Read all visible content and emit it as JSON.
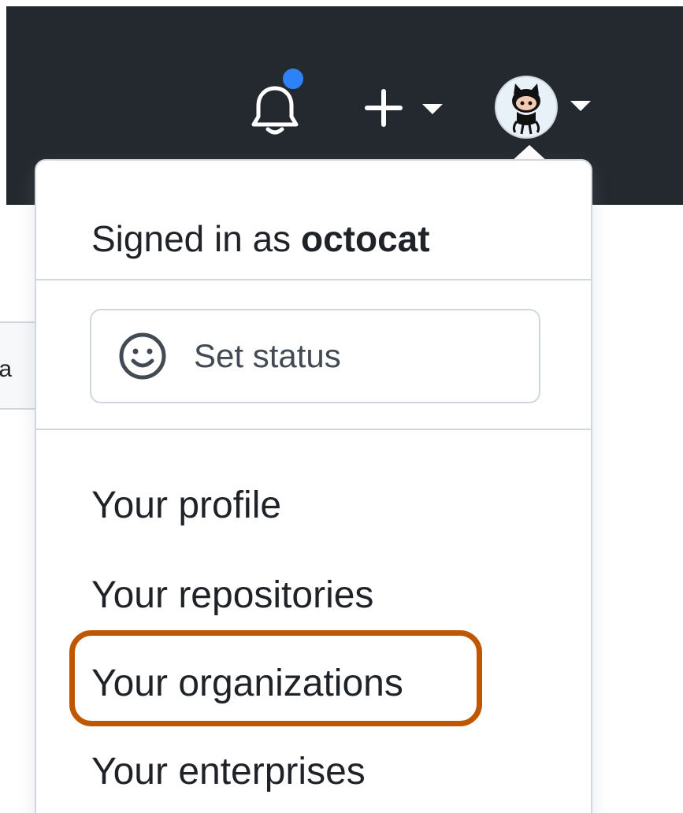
{
  "header": {
    "bell_icon": "bell-icon",
    "notification_dot_color": "#2f81f7",
    "plus_icon": "plus-icon",
    "caret_icon": "caret-down-icon",
    "avatar_icon": "octocat-avatar"
  },
  "background": {
    "partial_text": "ıa"
  },
  "dropdown": {
    "signed_in_prefix": "Signed in as ",
    "username": "octocat",
    "set_status_label": "Set status",
    "menu": {
      "profile": "Your profile",
      "repositories": "Your repositories",
      "organizations": "Your organizations",
      "enterprises": "Your enterprises"
    },
    "highlight_color": "#bf5700"
  }
}
